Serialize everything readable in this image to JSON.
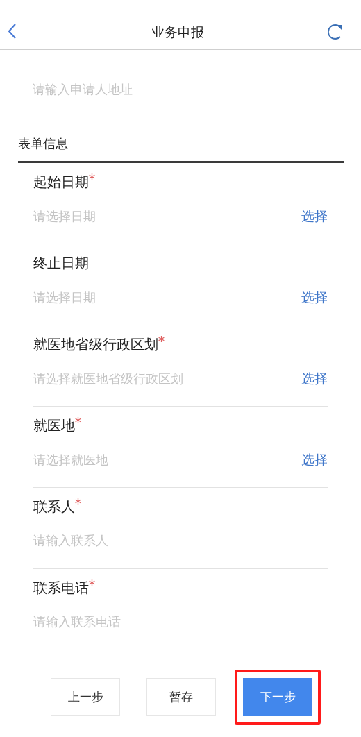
{
  "header": {
    "title": "业务申报"
  },
  "top_field": {
    "placeholder": "请输入申请人地址"
  },
  "section": {
    "title": "表单信息"
  },
  "fields": [
    {
      "label": "起始日期",
      "required": true,
      "kind": "select",
      "placeholder": "请选择日期",
      "action": "选择"
    },
    {
      "label": "终止日期",
      "required": false,
      "kind": "select",
      "placeholder": "请选择日期",
      "action": "选择"
    },
    {
      "label": "就医地省级行政区划",
      "required": true,
      "kind": "select",
      "placeholder": "请选择就医地省级行政区划",
      "action": "选择"
    },
    {
      "label": "就医地",
      "required": true,
      "kind": "select",
      "placeholder": "请选择就医地",
      "action": "选择"
    },
    {
      "label": "联系人",
      "required": true,
      "kind": "input",
      "placeholder": "请输入联系人"
    },
    {
      "label": "联系电话",
      "required": true,
      "kind": "input",
      "placeholder": "请输入联系电话"
    }
  ],
  "buttons": [
    {
      "label": "上一步",
      "primary": false,
      "highlighted": false
    },
    {
      "label": "暂存",
      "primary": false,
      "highlighted": false
    },
    {
      "label": "下一步",
      "primary": true,
      "highlighted": true
    }
  ]
}
